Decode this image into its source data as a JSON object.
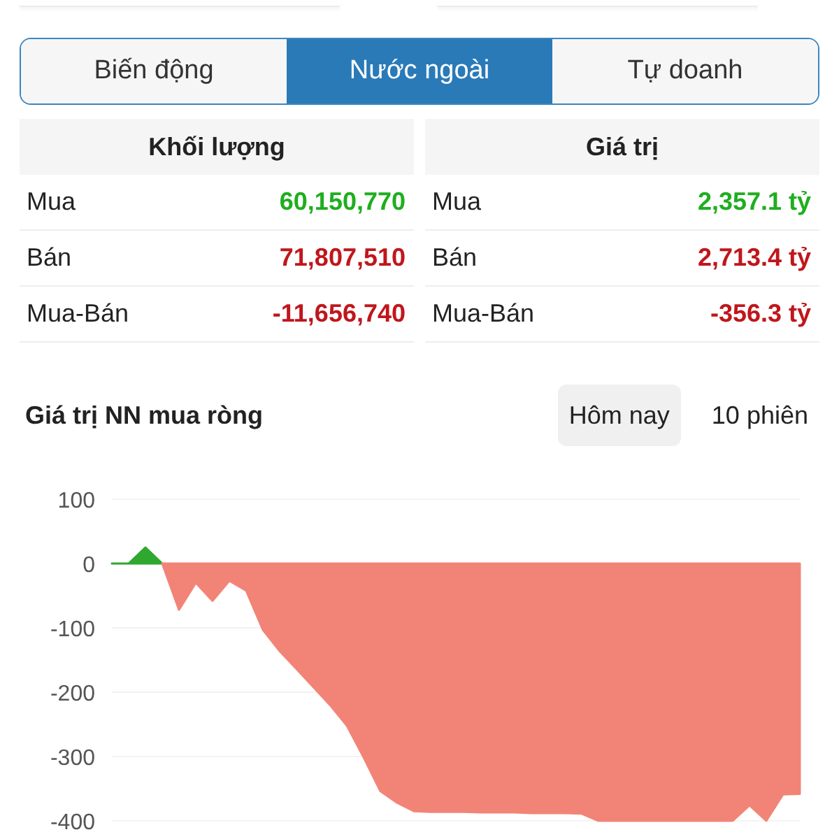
{
  "tabs": [
    {
      "label": "Biến động",
      "selected": false
    },
    {
      "label": "Nước ngoài",
      "selected": true
    },
    {
      "label": "Tự doanh",
      "selected": false
    }
  ],
  "tables": [
    {
      "title": "Khối lượng",
      "rows": [
        {
          "label": "Mua",
          "value": "60,150,770",
          "color": "#1fae1f"
        },
        {
          "label": "Bán",
          "value": "71,807,510",
          "color": "#c0161c"
        },
        {
          "label": "Mua-Bán",
          "value": "-11,656,740",
          "color": "#c0161c"
        }
      ]
    },
    {
      "title": "Giá trị",
      "rows": [
        {
          "label": "Mua",
          "value": "2,357.1 tỷ",
          "color": "#1fae1f"
        },
        {
          "label": "Bán",
          "value": "2,713.4 tỷ",
          "color": "#c0161c"
        },
        {
          "label": "Mua-Bán",
          "value": "-356.3 tỷ",
          "color": "#c0161c"
        }
      ]
    }
  ],
  "chart_section": {
    "title": "Giá trị NN mua ròng",
    "periods": [
      {
        "label": "Hôm nay",
        "selected": true
      },
      {
        "label": "10 phiên",
        "selected": false
      }
    ],
    "chart_data": {
      "type": "area",
      "grid": true,
      "ylim": [
        -400,
        100
      ],
      "yticks": [
        100,
        0,
        -100,
        -200,
        -300,
        -400
      ],
      "series": [
        {
          "color": "#2ea82e",
          "values": [
            0,
            0,
            25,
            0,
            null,
            null,
            null,
            null,
            null,
            null,
            null,
            null,
            null,
            null,
            null,
            null,
            null,
            null,
            null,
            null,
            null,
            null,
            null,
            null,
            null,
            null,
            null,
            null,
            null,
            null,
            null,
            null,
            null,
            null,
            null,
            null,
            null,
            null,
            null,
            null,
            null,
            null
          ]
        },
        {
          "color": "#f28477",
          "values": [
            null,
            null,
            null,
            0,
            -72,
            -30,
            -58,
            -27,
            -42,
            -103,
            -136,
            -164,
            -192,
            -220,
            -252,
            -301,
            -354,
            -372,
            -385,
            -386,
            -386,
            -386,
            -387,
            -387,
            -387,
            -388,
            -388,
            -388,
            -389,
            -400,
            -400,
            -400,
            -400,
            -400,
            -400,
            -400,
            -400,
            -400,
            -376,
            -400,
            -359,
            -358
          ]
        }
      ]
    }
  }
}
